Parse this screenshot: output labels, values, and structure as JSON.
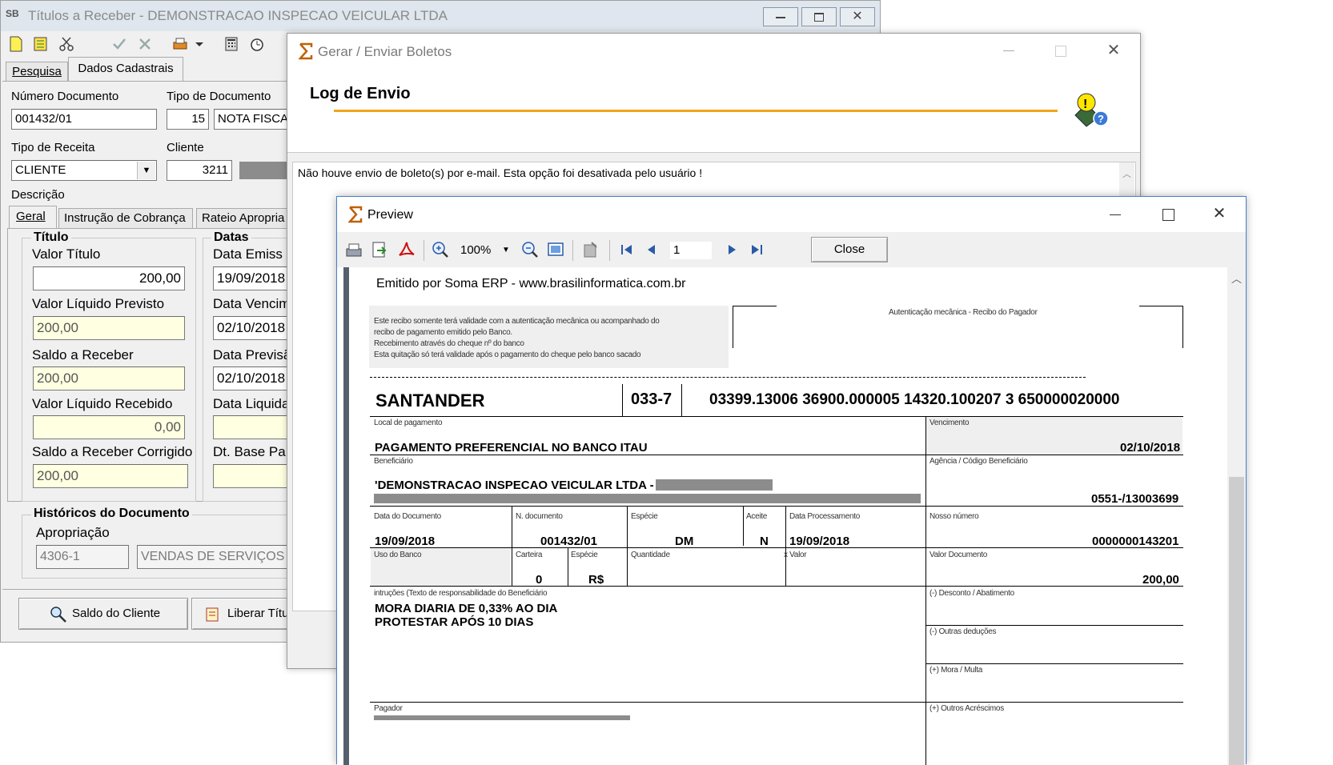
{
  "back_window": {
    "title": "Títulos a Receber - DEMONSTRACAO INSPECAO VEICULAR LTDA",
    "tabs": [
      "Pesquisa",
      "Dados Cadastrais"
    ],
    "labels": {
      "numero_documento": "Número Documento",
      "tipo_documento": "Tipo de Documento",
      "tipo_receita": "Tipo de Receita",
      "cliente": "Cliente",
      "descricao": "Descrição"
    },
    "values": {
      "numero_documento": "001432/01",
      "tipo_documento_code": "15",
      "tipo_documento_name": "NOTA FISCA",
      "tipo_receita": "CLIENTE",
      "cliente": "3211"
    },
    "subtabs": [
      "Geral",
      "Instrução de Cobrança",
      "Rateio Apropria"
    ],
    "titulo_group": {
      "title": "Título",
      "valor_titulo_label": "Valor Título",
      "valor_titulo": "200,00",
      "valor_liquido_previsto_label": "Valor Líquido Previsto",
      "valor_liquido_previsto": "200,00",
      "saldo_receber_label": "Saldo a Receber",
      "saldo_receber": "200,00",
      "valor_liquido_recebido_label": "Valor Líquido Recebido",
      "valor_liquido_recebido": "0,00",
      "saldo_corrigido_label": "Saldo a Receber Corrigido",
      "saldo_corrigido": "200,00"
    },
    "datas_group": {
      "title": "Datas",
      "emissao_label": "Data Emiss",
      "emissao": "19/09/2018",
      "vencimento_label": "Data Vencim",
      "vencimento": "02/10/2018",
      "previsao_label": "Data Previsã",
      "previsao": "02/10/2018",
      "liquidacao_label": "Data Liquida",
      "base_label": "Dt. Base Pa"
    },
    "historicos": {
      "title": "Históricos do Documento",
      "apropriacao_label": "Apropriação",
      "apropriacao_code": "4306-1",
      "apropriacao_name": "VENDAS DE SERVIÇOS"
    },
    "buttons": {
      "saldo_cliente": "Saldo do Cliente",
      "liberar_titulo": "Liberar Títu"
    }
  },
  "gerar_window": {
    "title": "Gerar / Enviar Boletos",
    "header": "Log de Envio",
    "log_text": "Não houve envio de boleto(s) por e-mail. Esta opção foi desativada pelo usuário !"
  },
  "preview_window": {
    "title": "Preview",
    "zoom": "100%",
    "page": "1",
    "close_label": "Close",
    "boleto": {
      "emitido": "Emitido por Soma ERP - www.brasilinformatica.com.br",
      "recibo_lines": [
        "Este recibo somente terá validade com a autenticação mecânica ou acompanhado do",
        "recibo de pagamento emitido pelo Banco.",
        "Recebimento através do cheque nº                                do banco",
        "Esta quitação só terá validade após o pagamento do cheque pelo banco sacado"
      ],
      "autenticacao": "Autenticação mecânica - Recibo do Pagador",
      "bank": "SANTANDER",
      "bank_code": "033-7",
      "linha_digitavel": "03399.13006 36900.000005 14320.100207 3 650000020000",
      "local_pagamento_label": "Local de pagamento",
      "local_pagamento": "PAGAMENTO PREFERENCIAL NO BANCO ITAU",
      "vencimento_label": "Vencimento",
      "vencimento": "02/10/2018",
      "beneficiario_label": "Beneficiário",
      "beneficiario": "'DEMONSTRACAO INSPECAO VEICULAR LTDA -",
      "agencia_label": "Agência / Código Beneficiário",
      "agencia": "0551-/13003699",
      "data_documento_label": "Data do Documento",
      "data_documento": "19/09/2018",
      "n_documento_label": "N. documento",
      "n_documento": "001432/01",
      "especie_label": "Espécie",
      "especie": "DM",
      "aceite_label": "Aceite",
      "aceite": "N",
      "data_processamento_label": "Data Processamento",
      "data_processamento": "19/09/2018",
      "nosso_numero_label": "Nosso número",
      "nosso_numero": "0000000143201",
      "uso_banco_label": "Uso do Banco",
      "carteira_label": "Carteira",
      "carteira": "0",
      "especie2_label": "Espécie",
      "especie2": "R$",
      "quantidade_label": "Quantidade",
      "valor_label": "x Valor",
      "valor_documento_label": "Valor Documento",
      "valor_documento": "200,00",
      "instrucoes_label": "intruções (Texto de responsabilidade do Beneficiário",
      "instrucoes": [
        "MORA DIARIA DE 0,33% AO DIA",
        "PROTESTAR APÓS 10 DIAS"
      ],
      "desconto_label": "(-) Desconto /  Abatimento",
      "outras_deducoes_label": "(-) Outras deduções",
      "mora_label": "(+) Mora / Multa",
      "pagador_label": "Pagador",
      "outros_acrescimos_label": "(+) Outros Acréscimos"
    }
  }
}
